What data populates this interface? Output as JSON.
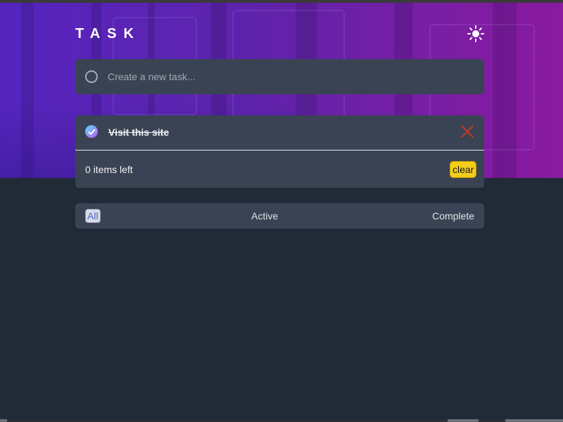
{
  "app": {
    "title": "TASK",
    "theme_icon": "sun-icon"
  },
  "new_task": {
    "placeholder": "Create a new task..."
  },
  "tasks": [
    {
      "text": "Visit this site",
      "completed": true
    }
  ],
  "footer": {
    "items_left": "0 items left",
    "clear_label": "clear"
  },
  "filters": {
    "all": "All",
    "active": "Active",
    "complete": "Complete",
    "selected": "All"
  },
  "colors": {
    "background": "#212a37",
    "card": "#3a4353",
    "hero_start": "#5c24d2",
    "hero_end": "#9618aa",
    "check_gradient": [
      "#57ddff",
      "#c058f3"
    ],
    "delete": "#c0392b",
    "clear_button": "#f4cd1c"
  }
}
